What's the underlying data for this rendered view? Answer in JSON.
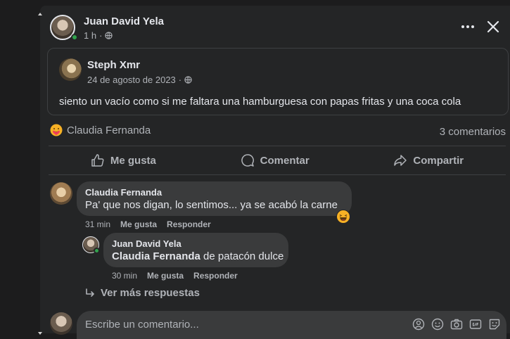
{
  "post": {
    "author": "Juan David Yela",
    "time": "1 h",
    "separator": "·"
  },
  "shared_post": {
    "author": "Steph Xmr",
    "date": "24 de agosto de 2023",
    "separator": "·",
    "text": "siento un vacío como si me faltara una hamburguesa con papas fritas y una coca cola"
  },
  "reactions": {
    "names": "Claudia Fernanda",
    "comment_count": "3 comentarios"
  },
  "actions": {
    "like": "Me gusta",
    "comment": "Comentar",
    "share": "Compartir"
  },
  "comments": [
    {
      "author": "Claudia Fernanda",
      "text": "Pa' que nos digan, lo sentimos... ya se acabó la carne",
      "time": "31 min",
      "like": "Me gusta",
      "reply": "Responder"
    },
    {
      "author": "Juan David Yela",
      "mention": "Claudia Fernanda",
      "text": "de patacón dulce",
      "time": "30 min",
      "like": "Me gusta",
      "reply": "Responder"
    }
  ],
  "more_replies": "Ver más respuestas",
  "compose": {
    "placeholder": "Escribe un comentario..."
  },
  "colors": {
    "background": "#242526",
    "bubble": "#3a3b3c",
    "online": "#31a24c",
    "text_primary": "#e4e6eb",
    "text_secondary": "#b0b3b8"
  }
}
